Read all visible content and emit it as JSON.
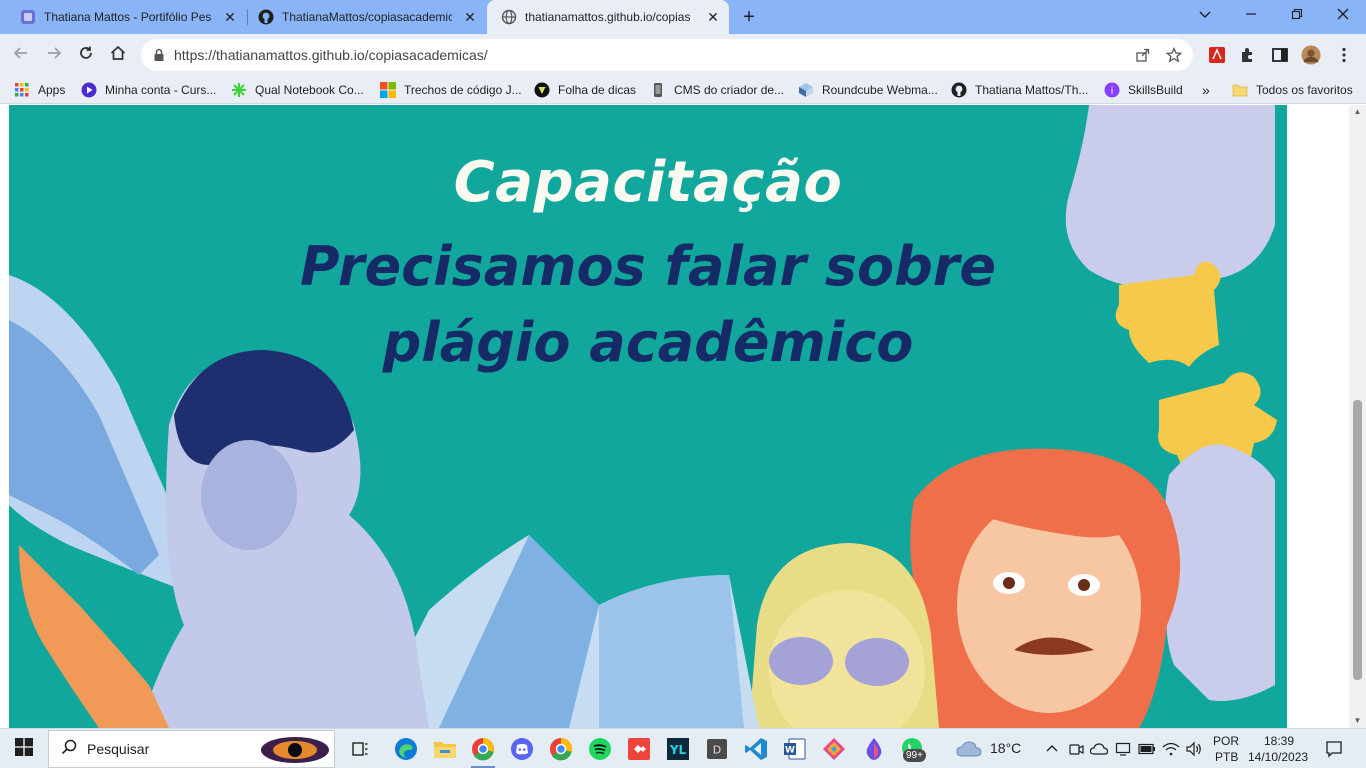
{
  "browser": {
    "tabs": [
      {
        "title": "Thatiana Mattos - Portifólio Pes",
        "icon": "portfolio-favicon",
        "active": false
      },
      {
        "title": "ThatianaMattos/copiasacademic",
        "icon": "github-icon",
        "active": false
      },
      {
        "title": "thatianamattos.github.io/copias",
        "icon": "globe-icon",
        "active": true
      }
    ],
    "close_glyph": "✕",
    "new_tab_glyph": "+",
    "url": "https://thatianamattos.github.io/copiasacademicas/",
    "window_controls": [
      "chevron-down-icon",
      "minimize-icon",
      "restore-icon",
      "close-icon"
    ]
  },
  "bookmarks": [
    {
      "label": "Apps",
      "icon": "apps-grid-icon"
    },
    {
      "label": "Minha conta - Curs...",
      "icon": "play-icon"
    },
    {
      "label": "Qual Notebook Co...",
      "icon": "star-burst-icon"
    },
    {
      "label": "Trechos de código J...",
      "icon": "windows-grid-icon"
    },
    {
      "label": "Folha de dicas",
      "icon": "shield-icon"
    },
    {
      "label": "CMS do criador de...",
      "icon": "phone-icon"
    },
    {
      "label": "Roundcube Webma...",
      "icon": "cube-icon"
    },
    {
      "label": "Thatiana Mattos/Th...",
      "icon": "github-icon"
    },
    {
      "label": "SkillsBuild",
      "icon": "skillsbuild-icon"
    }
  ],
  "bookmarks_more": "»",
  "bookmarks_all": "Todos os favoritos",
  "page": {
    "kicker": "Capacitação",
    "title_line1": "Precisamos falar sobre",
    "title_line2": "plágio acadêmico"
  },
  "taskbar": {
    "search_placeholder": "Pesquisar",
    "weather": "18°C",
    "language_top": "POR",
    "language_bottom": "PTB",
    "time": "18:39",
    "date": "14/10/2023",
    "badge": "99+"
  },
  "colors": {
    "banner_bg": "#12a79c",
    "kicker_color": "#fafaf0",
    "title_color": "#162a67",
    "tabstrip_bg": "#8ab4f8"
  }
}
